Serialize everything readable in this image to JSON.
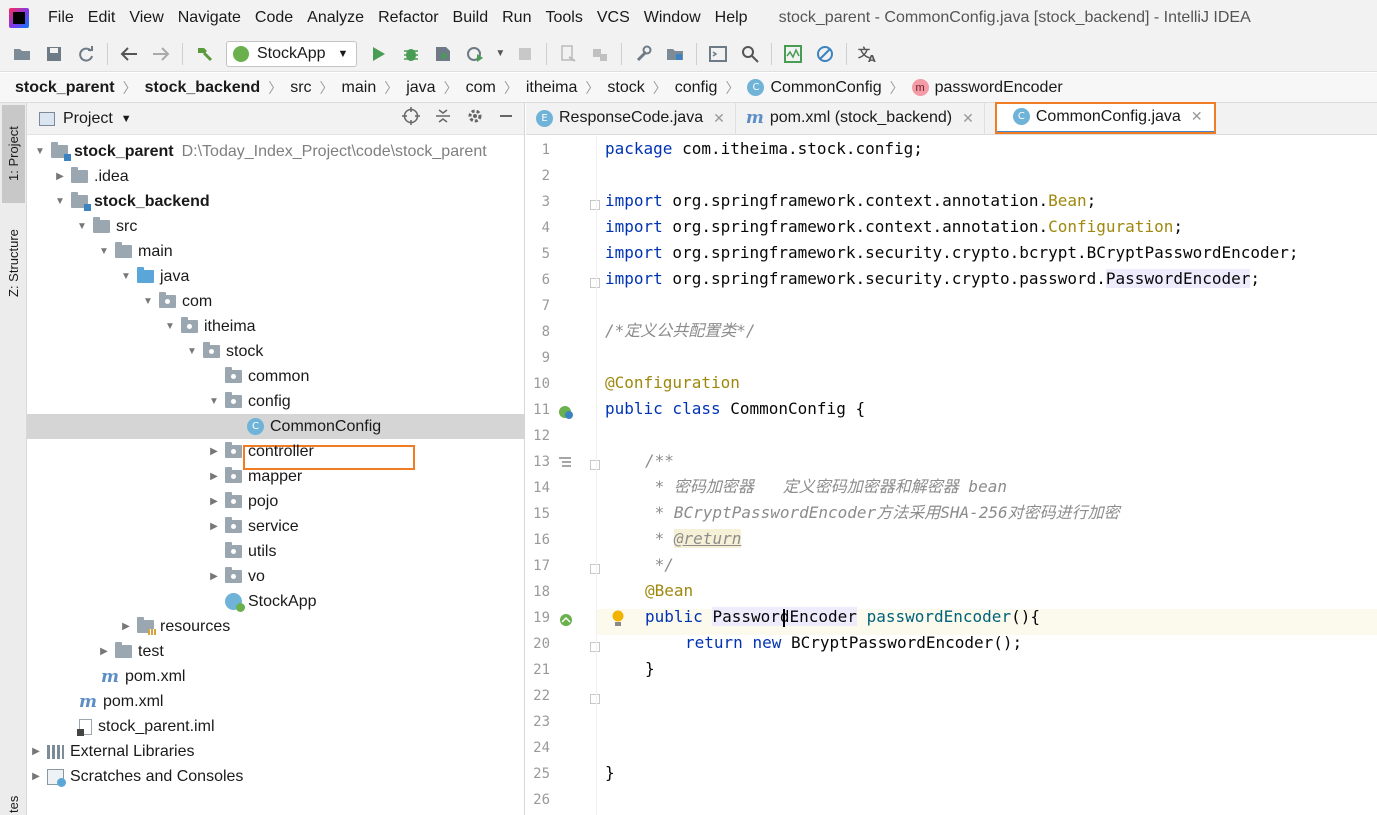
{
  "menu": {
    "items": [
      "File",
      "Edit",
      "View",
      "Navigate",
      "Code",
      "Analyze",
      "Refactor",
      "Build",
      "Run",
      "Tools",
      "VCS",
      "Window",
      "Help"
    ],
    "window_title": "stock_parent - CommonConfig.java [stock_backend] - IntelliJ IDEA"
  },
  "toolbar": {
    "run_config": "StockApp"
  },
  "breadcrumb": {
    "items": [
      "stock_parent",
      "stock_backend",
      "src",
      "main",
      "java",
      "com",
      "itheima",
      "stock",
      "config",
      "CommonConfig",
      "passwordEncoder"
    ]
  },
  "side_tabs": {
    "project": "1: Project",
    "structure": "Z: Structure",
    "favorites": "tes"
  },
  "project_panel": {
    "title": "Project",
    "root_name": "stock_parent",
    "root_path": "D:\\Today_Index_Project\\code\\stock_parent",
    "tree": [
      {
        "label": ".idea"
      },
      {
        "label": "stock_backend"
      },
      {
        "label": "src"
      },
      {
        "label": "main"
      },
      {
        "label": "java"
      },
      {
        "label": "com"
      },
      {
        "label": "itheima"
      },
      {
        "label": "stock"
      },
      {
        "label": "common"
      },
      {
        "label": "config"
      },
      {
        "label": "CommonConfig"
      },
      {
        "label": "controller"
      },
      {
        "label": "mapper"
      },
      {
        "label": "pojo"
      },
      {
        "label": "service"
      },
      {
        "label": "utils"
      },
      {
        "label": "vo"
      },
      {
        "label": "StockApp"
      },
      {
        "label": "resources"
      },
      {
        "label": "test"
      },
      {
        "label": "pom.xml"
      },
      {
        "label": "pom.xml"
      },
      {
        "label": "stock_parent.iml"
      },
      {
        "label": "External Libraries"
      },
      {
        "label": "Scratches and Consoles"
      }
    ]
  },
  "editor": {
    "tabs": [
      {
        "label": "ResponseCode.java"
      },
      {
        "label": "pom.xml (stock_backend)"
      },
      {
        "label": "CommonConfig.java"
      }
    ],
    "line_numbers": [
      "1",
      "2",
      "3",
      "4",
      "5",
      "6",
      "7",
      "8",
      "9",
      "10",
      "11",
      "12",
      "13",
      "14",
      "15",
      "16",
      "17",
      "18",
      "19",
      "20",
      "21",
      "22",
      "23",
      "24",
      "25",
      "26"
    ],
    "code": {
      "l1_kw": "package",
      "l1_rest": " com.itheima.stock.config;",
      "import_kw": "import",
      "l3_pkg": " org.springframework.context.annotation.",
      "l3_cls": "Bean",
      "l3_end": ";",
      "l4_pkg": " org.springframework.context.annotation.",
      "l4_cls": "Configuration",
      "l4_end": ";",
      "l5_rest": " org.springframework.security.crypto.bcrypt.BCryptPasswordEncoder;",
      "l6_pkg": " org.springframework.security.crypto.password.",
      "l6_cls": "PasswordEncoder",
      "l6_end": ";",
      "l8": "/*定义公共配置类*/",
      "l10": "@Configuration",
      "l11_kw": "public class",
      "l11_rest": " CommonConfig {",
      "l13": "/**",
      "l14": " * 密码加密器   定义密码加密器和解密器 bean",
      "l15": " * BCryptPasswordEncoder方法采用SHA-256对密码进行加密",
      "l16_star": " * ",
      "l16_tag": "@return",
      "l17": " */",
      "l18": "@Bean",
      "l19_kw": "public",
      "l19_type": "PasswordEncoder",
      "l19_method": "passwordEncoder",
      "l19_end": "(){",
      "l20_kw1": "return",
      "l20_kw2": "new",
      "l20_rest": " BCryptPasswordEncoder();",
      "l21": "}",
      "l25": "}"
    }
  },
  "colors": {
    "highlight_box": "#f07c24",
    "keyword": "#0033b3",
    "annotation": "#9e880d",
    "comment": "#8c8c8c"
  }
}
